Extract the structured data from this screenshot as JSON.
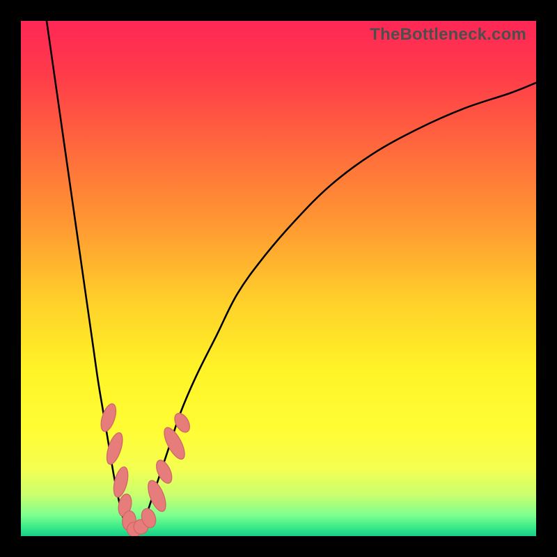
{
  "watermark": "TheBottleneck.com",
  "colors": {
    "frame": "#000000",
    "curve_stroke": "#000000",
    "marker_fill": "#e77d7a",
    "marker_stroke": "#cf6769"
  },
  "gradient_stops": [
    {
      "offset": 0.0,
      "color": "#ff2756"
    },
    {
      "offset": 0.1,
      "color": "#ff3a4a"
    },
    {
      "offset": 0.25,
      "color": "#ff6a3c"
    },
    {
      "offset": 0.4,
      "color": "#ff9a32"
    },
    {
      "offset": 0.55,
      "color": "#ffd22a"
    },
    {
      "offset": 0.68,
      "color": "#fff427"
    },
    {
      "offset": 0.8,
      "color": "#fffd36"
    },
    {
      "offset": 0.87,
      "color": "#f4ff52"
    },
    {
      "offset": 0.92,
      "color": "#c9ff6e"
    },
    {
      "offset": 0.96,
      "color": "#7dff8f"
    },
    {
      "offset": 0.985,
      "color": "#33e789"
    },
    {
      "offset": 1.0,
      "color": "#19cf87"
    }
  ],
  "chart_data": {
    "type": "line",
    "title": "",
    "xlabel": "",
    "ylabel": "",
    "xlim": [
      0,
      100
    ],
    "ylim": [
      0,
      100
    ],
    "series": [
      {
        "name": "bottleneck-curve",
        "x": [
          5,
          6,
          7,
          8,
          9,
          10,
          11,
          12,
          13,
          14,
          15,
          16,
          17,
          18,
          19,
          20,
          21,
          22,
          23,
          24,
          25,
          27,
          29,
          31,
          34,
          38,
          42,
          47,
          53,
          60,
          68,
          77,
          86,
          95,
          100
        ],
        "y": [
          100,
          93,
          86,
          79,
          72,
          65,
          58,
          51,
          44,
          37,
          30,
          24,
          18,
          12,
          7,
          3,
          1,
          0,
          1,
          3,
          6,
          12,
          18,
          24,
          31,
          39,
          47,
          54,
          61,
          68,
          74,
          79,
          83,
          86,
          88
        ]
      }
    ],
    "markers": [
      {
        "x": 17.0,
        "y": 23.0,
        "rx": 1.2,
        "ry": 2.8,
        "rot": 18
      },
      {
        "x": 18.2,
        "y": 17.0,
        "rx": 1.2,
        "ry": 3.2,
        "rot": 18
      },
      {
        "x": 19.4,
        "y": 10.5,
        "rx": 1.2,
        "ry": 3.0,
        "rot": 14
      },
      {
        "x": 20.2,
        "y": 6.0,
        "rx": 1.2,
        "ry": 2.2,
        "rot": 12
      },
      {
        "x": 21.0,
        "y": 3.0,
        "rx": 1.3,
        "ry": 1.9,
        "rot": 5
      },
      {
        "x": 22.0,
        "y": 1.3,
        "rx": 1.4,
        "ry": 1.4,
        "rot": 0
      },
      {
        "x": 23.3,
        "y": 1.8,
        "rx": 1.4,
        "ry": 1.4,
        "rot": 0
      },
      {
        "x": 24.8,
        "y": 3.5,
        "rx": 1.3,
        "ry": 1.9,
        "rot": -18
      },
      {
        "x": 26.4,
        "y": 7.8,
        "rx": 1.3,
        "ry": 3.2,
        "rot": -22
      },
      {
        "x": 27.8,
        "y": 12.5,
        "rx": 1.2,
        "ry": 2.4,
        "rot": -25
      },
      {
        "x": 29.8,
        "y": 18.0,
        "rx": 1.3,
        "ry": 3.4,
        "rot": -28
      },
      {
        "x": 31.3,
        "y": 22.0,
        "rx": 1.2,
        "ry": 2.0,
        "rot": -30
      }
    ]
  }
}
